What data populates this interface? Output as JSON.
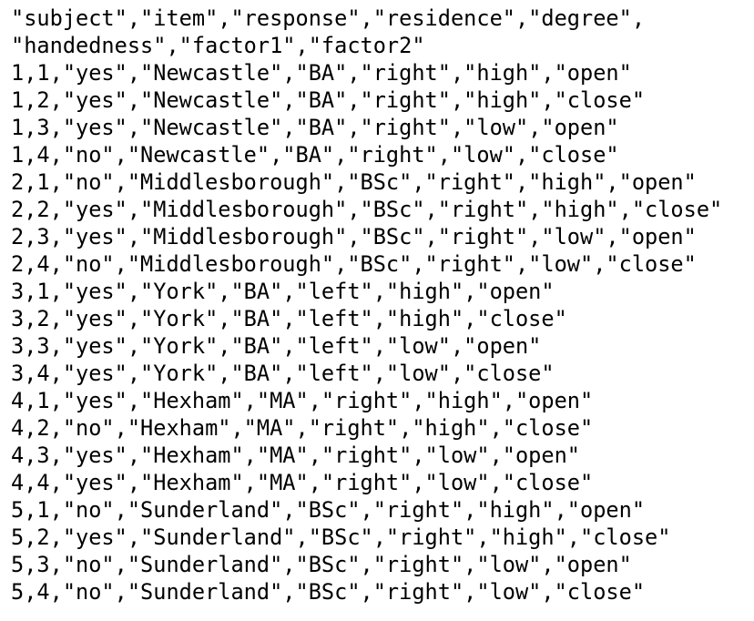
{
  "document": {
    "lines": [
      "\"subject\",\"item\",\"response\",\"residence\",\"degree\",",
      "\"handedness\",\"factor1\",\"factor2\"",
      "1,1,\"yes\",\"Newcastle\",\"BA\",\"right\",\"high\",\"open\"",
      "1,2,\"yes\",\"Newcastle\",\"BA\",\"right\",\"high\",\"close\"",
      "1,3,\"yes\",\"Newcastle\",\"BA\",\"right\",\"low\",\"open\"",
      "1,4,\"no\",\"Newcastle\",\"BA\",\"right\",\"low\",\"close\"",
      "2,1,\"no\",\"Middlesborough\",\"BSc\",\"right\",\"high\",\"open\"",
      "2,2,\"yes\",\"Middlesborough\",\"BSc\",\"right\",\"high\",\"close\"",
      "2,3,\"yes\",\"Middlesborough\",\"BSc\",\"right\",\"low\",\"open\"",
      "2,4,\"no\",\"Middlesborough\",\"BSc\",\"right\",\"low\",\"close\"",
      "3,1,\"yes\",\"York\",\"BA\",\"left\",\"high\",\"open\"",
      "3,2,\"yes\",\"York\",\"BA\",\"left\",\"high\",\"close\"",
      "3,3,\"yes\",\"York\",\"BA\",\"left\",\"low\",\"open\"",
      "3,4,\"yes\",\"York\",\"BA\",\"left\",\"low\",\"close\"",
      "4,1,\"yes\",\"Hexham\",\"MA\",\"right\",\"high\",\"open\"",
      "4,2,\"no\",\"Hexham\",\"MA\",\"right\",\"high\",\"close\"",
      "4,3,\"yes\",\"Hexham\",\"MA\",\"right\",\"low\",\"open\"",
      "4,4,\"yes\",\"Hexham\",\"MA\",\"right\",\"low\",\"close\"",
      "5,1,\"no\",\"Sunderland\",\"BSc\",\"right\",\"high\",\"open\"",
      "5,2,\"yes\",\"Sunderland\",\"BSc\",\"right\",\"high\",\"close\"",
      "5,3,\"no\",\"Sunderland\",\"BSc\",\"right\",\"low\",\"open\"",
      "5,4,\"no\",\"Sunderland\",\"BSc\",\"right\",\"low\",\"close\""
    ]
  }
}
